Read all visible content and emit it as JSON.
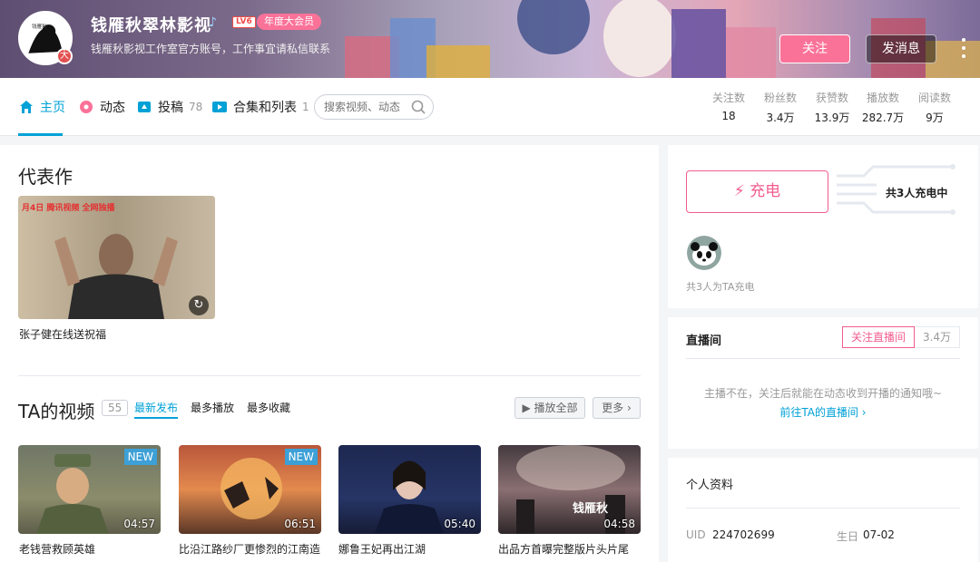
{
  "profile": {
    "name": "钱雁秋翠林影视",
    "level": "LV6",
    "vip": "年度大会员",
    "sign": "钱雁秋影视工作室官方账号，工作事宜请私信联系",
    "avatar_badge": "大"
  },
  "actions": {
    "follow": "关注",
    "message": "发消息"
  },
  "nav": {
    "items": [
      {
        "label": "主页",
        "count": "",
        "icon": "home-icon"
      },
      {
        "label": "动态",
        "count": "",
        "icon": "dynamic-icon"
      },
      {
        "label": "投稿",
        "count": "78",
        "icon": "upload-icon"
      },
      {
        "label": "合集和列表",
        "count": "1",
        "icon": "playlist-icon"
      }
    ],
    "search_placeholder": "搜索视频、动态"
  },
  "stats": [
    {
      "label": "关注数",
      "value": "18"
    },
    {
      "label": "粉丝数",
      "value": "3.4万"
    },
    {
      "label": "获赞数",
      "value": "13.9万"
    },
    {
      "label": "播放数",
      "value": "282.7万"
    },
    {
      "label": "阅读数",
      "value": "9万"
    }
  ],
  "masterpiece": {
    "title": "代表作",
    "video": {
      "title": "张子健在线送祝福",
      "tag": "月4日 腾讯视频 全网独播"
    }
  },
  "ta_videos": {
    "title": "TA的视频",
    "count": "55",
    "tabs": [
      "最新发布",
      "最多播放",
      "最多收藏"
    ],
    "play_all": "播放全部",
    "more": "更多",
    "items": [
      {
        "title": "老钱营救顾英雄",
        "duration": "04:57",
        "new": "NEW"
      },
      {
        "title": "比沿江路纱厂更惨烈的江南造",
        "duration": "06:51",
        "new": "NEW"
      },
      {
        "title": "娜鲁王妃再出江湖",
        "duration": "05:40",
        "new": ""
      },
      {
        "title": "出品方首曝完整版片头片尾",
        "duration": "04:58",
        "new": ""
      }
    ]
  },
  "charge": {
    "button": "充电",
    "count_text": "共3人充电中",
    "sub": "共3人为TA充电"
  },
  "live": {
    "title": "直播间",
    "follow": "关注直播间",
    "fans": "3.4万",
    "msg": "主播不在，关注后就能在动态收到开播的通知哦~",
    "link": "前往TA的直播间"
  },
  "info": {
    "title": "个人资料",
    "uid_label": "UID",
    "uid": "224702699",
    "birthday_label": "生日",
    "birthday": "07-02"
  },
  "colors": {
    "accent": "#00a1d6",
    "pink": "#fb7299"
  }
}
